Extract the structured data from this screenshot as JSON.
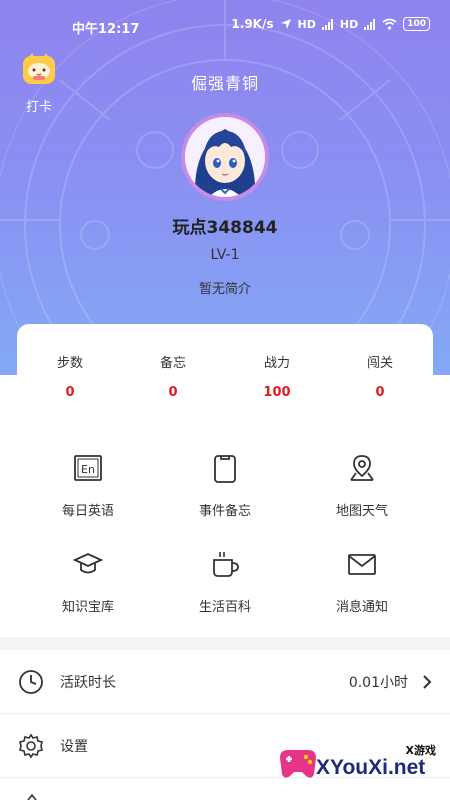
{
  "status_bar": {
    "time": "中午12:17",
    "speed": "1.9K/s",
    "signal1": "HD",
    "signal2": "HD",
    "battery": "100"
  },
  "checkin": {
    "label": "打卡",
    "icon": "calendar-cat-icon"
  },
  "profile": {
    "rank_title": "倔强青铜",
    "username": "玩点348844",
    "level": "LV-1",
    "bio": "暂无简介",
    "avatar": "anime-girl-avatar"
  },
  "stats": [
    {
      "label": "步数",
      "value": "0"
    },
    {
      "label": "备忘",
      "value": "0"
    },
    {
      "label": "战力",
      "value": "100"
    },
    {
      "label": "闯关",
      "value": "0"
    }
  ],
  "features": [
    {
      "label": "每日英语",
      "icon": "english-icon"
    },
    {
      "label": "事件备忘",
      "icon": "clipboard-icon"
    },
    {
      "label": "地图天气",
      "icon": "map-pin-icon"
    },
    {
      "label": "知识宝库",
      "icon": "graduation-cap-icon"
    },
    {
      "label": "生活百科",
      "icon": "coffee-cup-icon"
    },
    {
      "label": "消息通知",
      "icon": "envelope-icon"
    }
  ],
  "list": {
    "active_time": {
      "label": "活跃时长",
      "value": "0.01小时"
    },
    "settings": {
      "label": "设置"
    }
  },
  "watermark": {
    "text": "XYouXi.net",
    "sub": "X游戏"
  },
  "colors": {
    "header_gradient_top": "#8f84ee",
    "header_gradient_bottom": "#84a9f6",
    "stat_value": "#e5191f",
    "avatar_ring": "#c58be8"
  }
}
